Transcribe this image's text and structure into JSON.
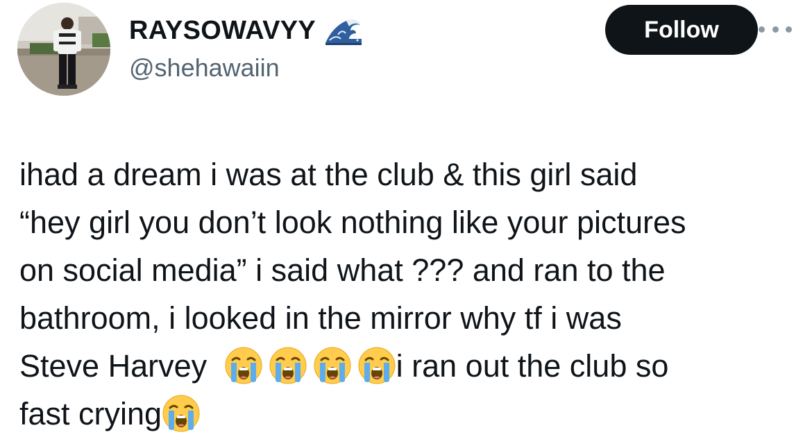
{
  "author": {
    "display_name": "RAYSOWAVYY",
    "handle": "@shehawaiin",
    "name_badge_icon": "water-wave-icon"
  },
  "actions": {
    "follow_label": "Follow",
    "more_icon": "more-options-icon"
  },
  "tweet": {
    "lines": [
      "ihad a dream i was at the club & this girl said",
      "“hey girl you don’t look nothing like your pictures",
      "on social media” i said what ??? and ran to the",
      "bathroom, i looked in the mirror why tf i was"
    ],
    "line5_start": "Steve Harvey",
    "line5_end": "i ran out the club so",
    "line6_start": "fast crying",
    "emoji": "loudly-crying-face-icon"
  },
  "colors": {
    "follow_button_bg": "#0f1419",
    "follow_button_text": "#ffffff",
    "handle": "#536471",
    "text": "#0f1419"
  }
}
